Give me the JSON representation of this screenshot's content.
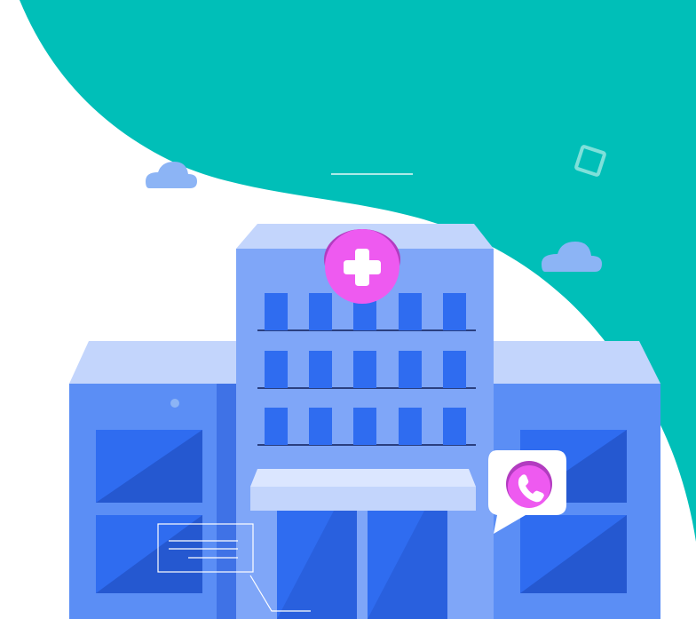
{
  "illustration": {
    "subject": "hospital-building",
    "icons": [
      "medical-cross-icon",
      "phone-icon"
    ]
  },
  "colors": {
    "background": "#ffffff",
    "teal_wave": "#00bfb8",
    "building_light": "#7fa6f8",
    "building_mid": "#5b8ef5",
    "building_side": "#3f72e6",
    "roof_light": "#c3d5fc",
    "window_blue": "#2f6cf0",
    "window_dark": "#2558d0",
    "cross_badge": "#ee5af0",
    "cross_badge_shadow": "#b23cc0",
    "cloud": "#8cb4f5",
    "phone_bubble": "#ffffff"
  }
}
